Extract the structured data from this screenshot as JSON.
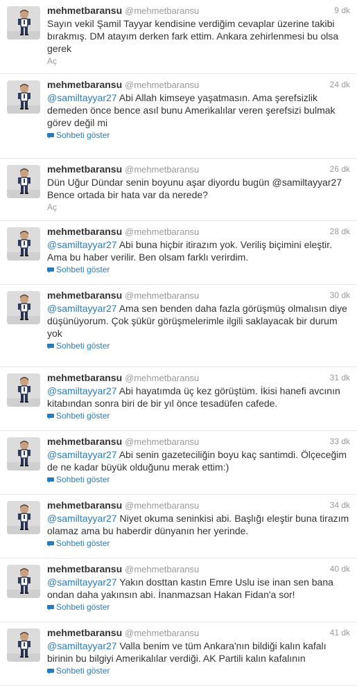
{
  "tweets": [
    {
      "name": "mehmetbaransu",
      "handle": "@mehmetbaransu",
      "time": "9 dk",
      "mention": "",
      "text": "Sayın vekil Şamil Tayyar kendisine verdiğim cevaplar üzerine takibi bırakmış. DM atayım derken fark ettim. Ankara zehirlenmesi bu olsa gerek",
      "action": "Aç",
      "action_type": "expand"
    },
    {
      "name": "mehmetbaransu",
      "handle": "@mehmetbaransu",
      "time": "24 dk",
      "mention": "@samiltayyar27",
      "text": " Abi Allah kimseye yaşatmasın. Ama şerefsizlik demeden önce bence asıl bunu Amerikalılar veren şerefsizi bulmak görev değil mi",
      "action": "Sohbeti göster",
      "action_type": "conversation"
    },
    {
      "name": "mehmetbaransu",
      "handle": "@mehmetbaransu",
      "time": "26 dk",
      "mention": "",
      "text": "Dün Uğur Dündar senin boyunu aşar diyordu bugün @samiltayyar27 Bence ortada bir hata var da nerede?",
      "action": "Aç",
      "action_type": "expand"
    },
    {
      "name": "mehmetbaransu",
      "handle": "@mehmetbaransu",
      "time": "28 dk",
      "mention": "@samiltayyar27",
      "text": " Abi buna hiçbir itirazım yok. Veriliş biçimini eleştir. Ama bu haber verilir. Ben olsam farklı verirdim.",
      "action": "Sohbeti göster",
      "action_type": "conversation"
    },
    {
      "name": "mehmetbaransu",
      "handle": "@mehmetbaransu",
      "time": "30 dk",
      "mention": "@samiltayyar27",
      "text": " Ama sen benden daha fazla görüşmüş olmalısın diye düşünüyorum. Çok şükür görüşmelerimle ilgili saklayacak bir durum yok",
      "action": "Sohbeti göster",
      "action_type": "conversation"
    },
    {
      "name": "mehmetbaransu",
      "handle": "@mehmetbaransu",
      "time": "31 dk",
      "mention": "@samiltayyar27",
      "text": " Abi hayatımda üç kez görüştüm. İkisi hanefi avcının kitabından sonra biri de bir yıl önce tesadüfen cafede.",
      "action": "Sohbeti göster",
      "action_type": "conversation"
    },
    {
      "name": "mehmetbaransu",
      "handle": "@mehmetbaransu",
      "time": "33 dk",
      "mention": "@samiltayyar27",
      "text": " Abi senin gazeteciliğin boyu kaç santimdi. Ölçeceğim de ne kadar büyük olduğunu merak ettim:)",
      "action": "Sohbeti göster",
      "action_type": "conversation"
    },
    {
      "name": "mehmetbaransu",
      "handle": "@mehmetbaransu",
      "time": "34 dk",
      "mention": "@samiltayyar27",
      "text": " Niyet okuma seninkisi abi. Başlığı eleştir buna tirazım olamaz ama bu haberdir dünyanın her yerinde.",
      "action": "Sohbeti göster",
      "action_type": "conversation"
    },
    {
      "name": "mehmetbaransu",
      "handle": "@mehmetbaransu",
      "time": "40 dk",
      "mention": "@samiltayyar27",
      "text": " Yakın dosttan kastın Emre Uslu ise inan sen bana ondan daha yakınsın abi. İnanmazsan Hakan Fidan'a sor!",
      "action": "Sohbeti göster",
      "action_type": "conversation"
    },
    {
      "name": "mehmetbaransu",
      "handle": "@mehmetbaransu",
      "time": "41 dk",
      "mention": "@samiltayyar27",
      "text": " Valla benim ve tüm Ankara'nın bildiği kalın kafalı birinin bu bilgiyi Amerikalılar verdiği. AK Partili kalın kafalının",
      "action": "Sohbeti göster",
      "action_type": "conversation"
    }
  ]
}
